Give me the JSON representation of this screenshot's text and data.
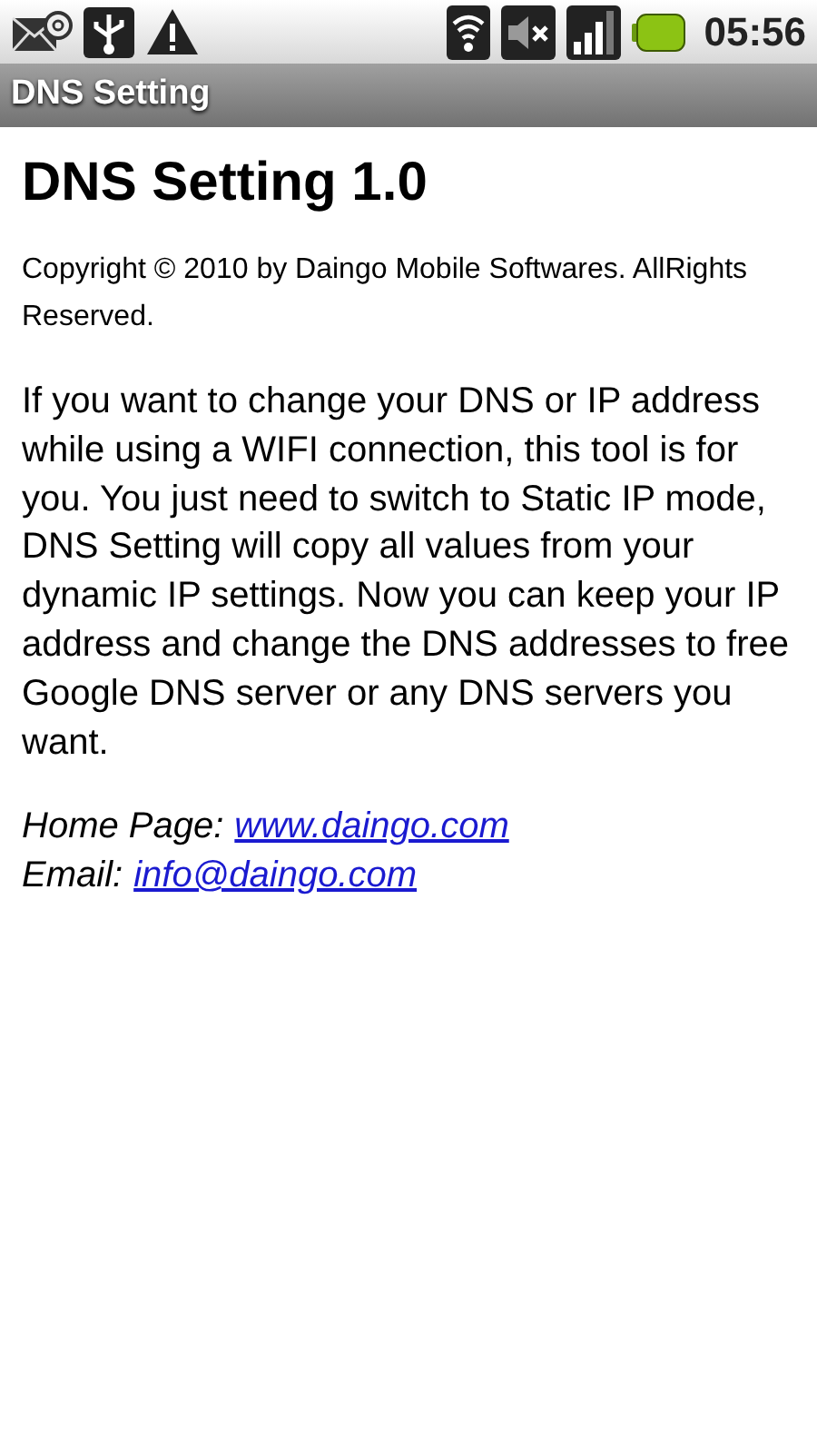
{
  "status_bar": {
    "time": "05:56"
  },
  "title_bar": {
    "title": "DNS Setting"
  },
  "heading": "DNS Setting 1.0",
  "copyright": "Copyright © 2010 by Daingo Mobile Softwares. AllRights Reserved.",
  "description": "If you want to change your DNS or IP address while using a WIFI connection, this tool is for you. You just need to switch to Static IP mode, DNS Setting will copy all values from your dynamic IP settings. Now you can keep your IP address and change the DNS addresses to free Google DNS server or any DNS servers you want.",
  "contacts": [
    {
      "label": "Home Page:",
      "link": "www.daingo.com"
    },
    {
      "label": "Email:",
      "link": "info@daingo.com"
    }
  ]
}
